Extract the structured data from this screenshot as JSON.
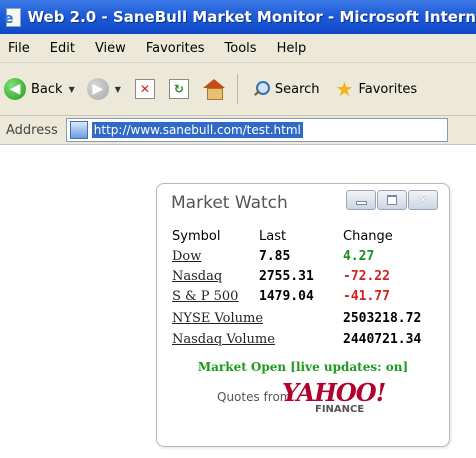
{
  "window": {
    "title": "Web 2.0 - SaneBull Market Monitor - Microsoft Intern"
  },
  "menubar": {
    "items": [
      "File",
      "Edit",
      "View",
      "Favorites",
      "Tools",
      "Help"
    ]
  },
  "toolbar": {
    "back_label": "Back",
    "search_label": "Search",
    "favorites_label": "Favorites"
  },
  "address": {
    "label": "Address",
    "url": "http://www.sanebull.com/test.html"
  },
  "widget": {
    "title": "Market Watch",
    "headers": {
      "symbol": "Symbol",
      "last": "Last",
      "change": "Change"
    },
    "rows": [
      {
        "symbol": "Dow",
        "last": "7.85",
        "change": "4.27",
        "direction": "up"
      },
      {
        "symbol": "Nasdaq",
        "last": "2755.31",
        "change": "-72.22",
        "direction": "down"
      },
      {
        "symbol": "S & P 500",
        "last": "1479.04",
        "change": "-41.77",
        "direction": "down"
      },
      {
        "symbol": "NYSE Volume",
        "last": "",
        "change": "2503218.72",
        "direction": "none"
      },
      {
        "symbol": "Nasdaq Volume",
        "last": "",
        "change": "2440721.34",
        "direction": "none"
      }
    ],
    "status": "Market Open [live updates: on]",
    "quotes_from": "Quotes from",
    "provider_logo": "YAHOO!",
    "provider_sub": "FINANCE"
  },
  "colors": {
    "title_bar": "#1f5bd6",
    "positive": "#1b8f1b",
    "negative": "#d42020",
    "status": "#1b9a1b",
    "yahoo": "#b3002d"
  }
}
